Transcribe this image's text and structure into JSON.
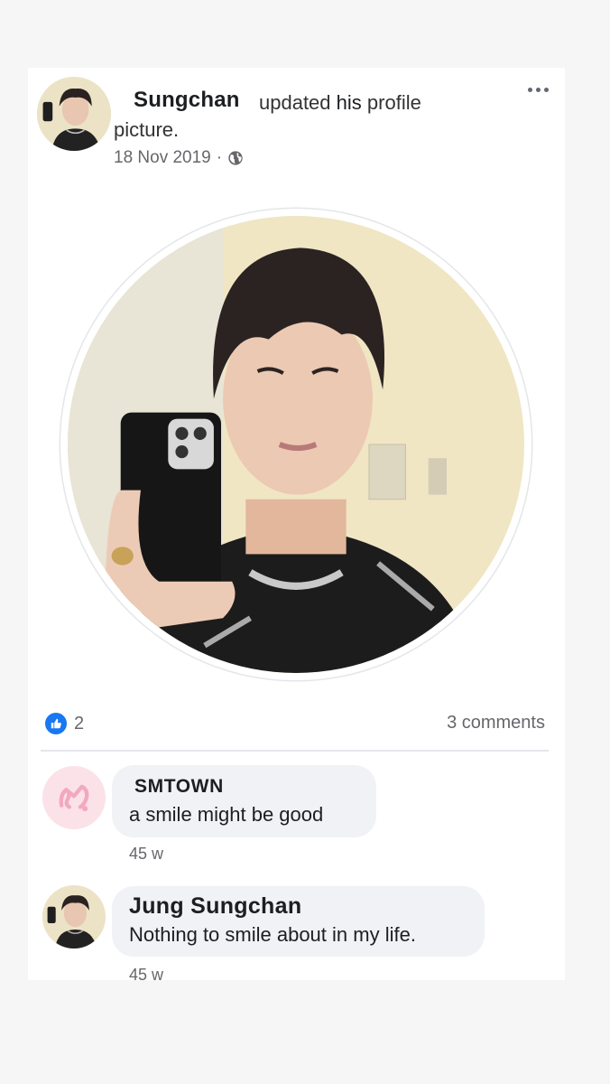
{
  "post": {
    "author": "Sungchan",
    "action": "updated",
    "action_his": "his",
    "action_rest": "profile",
    "action_cont": "picture.",
    "date": "18 Nov 2019",
    "separator": "·",
    "privacy_icon": "globe-icon",
    "more_icon": "more-options-icon",
    "reactions": {
      "icon": "like-icon",
      "count": "2"
    },
    "comments_count": "3 comments"
  },
  "comments": [
    {
      "author": "SMTOWN",
      "text": "a smile might be good",
      "time": "45 w",
      "avatar": "smtown-logo"
    },
    {
      "author": "Jung Sungchan",
      "text": "Nothing to smile about in my life.",
      "time": "45 w",
      "avatar": "profile-avatar"
    }
  ],
  "colors": {
    "accent": "#1877f2",
    "bubble": "#f0f2f5",
    "secondary_text": "#65676b",
    "smtown_pink": "#f3a9bd"
  }
}
